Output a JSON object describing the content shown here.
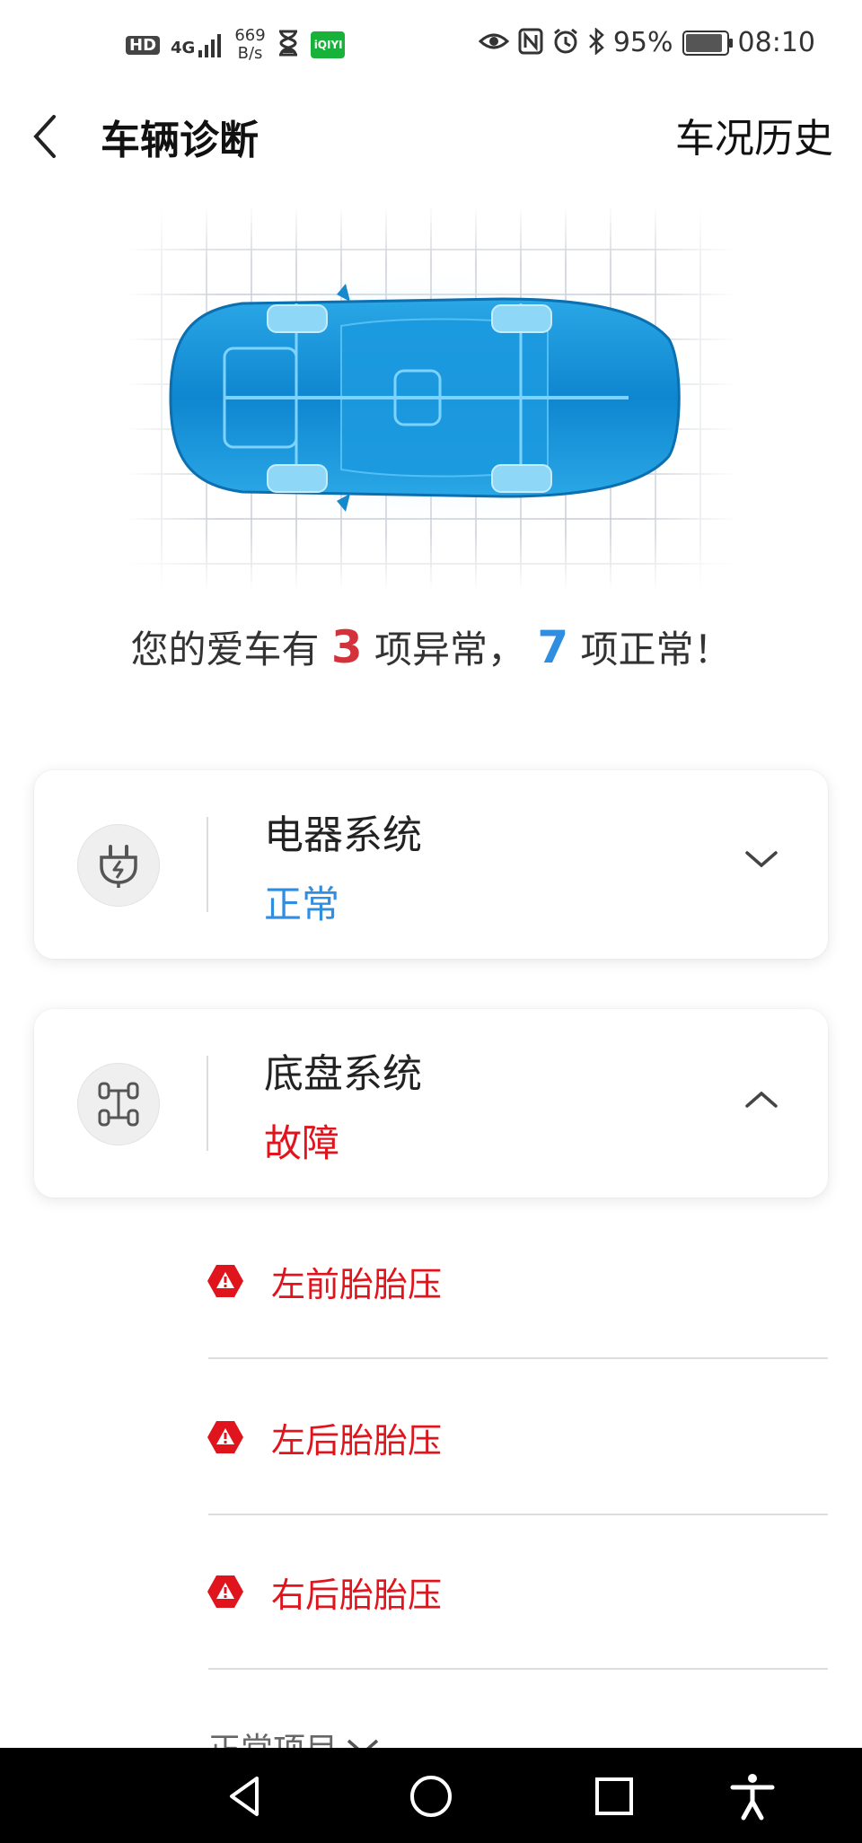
{
  "status_bar": {
    "hd": "HD",
    "network": "4G",
    "speed_value": "669",
    "speed_unit": "B/s",
    "battery_percent": "95%",
    "time": "08:10"
  },
  "header": {
    "title": "车辆诊断",
    "history_label": "车况历史"
  },
  "summary": {
    "prefix": "您的爱车有",
    "abnormal_count": "3",
    "middle": "项异常，",
    "normal_count": "7",
    "suffix": "项正常！"
  },
  "systems": [
    {
      "name": "电器系统",
      "status": "正常",
      "status_color": "#2f8ee0",
      "icon": "plug-icon",
      "expanded": false
    },
    {
      "name": "底盘系统",
      "status": "故障",
      "status_color": "#e0141d",
      "icon": "chassis-icon",
      "expanded": true
    }
  ],
  "chassis_issues": [
    {
      "label": "左前胎胎压",
      "icon": "warning-icon"
    },
    {
      "label": "左后胎胎压",
      "icon": "warning-icon"
    },
    {
      "label": "右后胎胎压",
      "icon": "warning-icon"
    }
  ],
  "normal_items_label": "正常项目",
  "colors": {
    "abnormal": "#d3323a",
    "normal": "#2f8ee0",
    "fault": "#e0141d"
  }
}
